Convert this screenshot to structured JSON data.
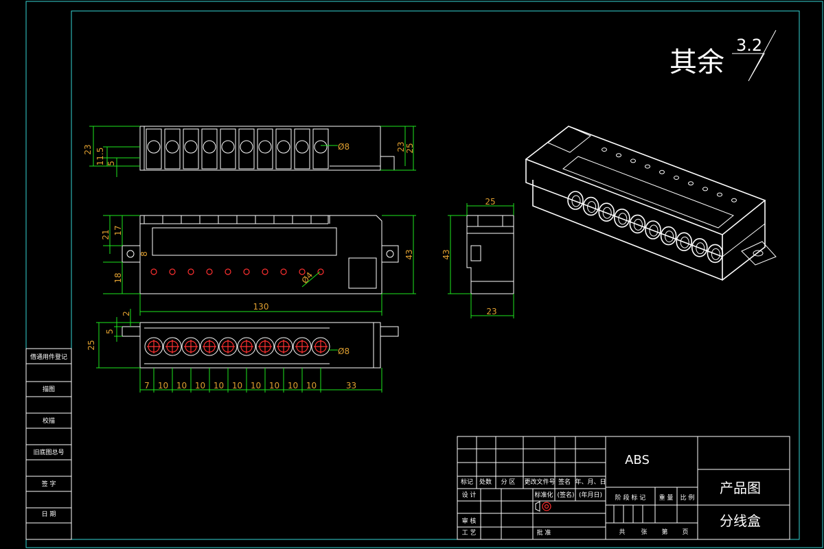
{
  "roughness": {
    "prefix": "其余",
    "value": "3.2"
  },
  "top_view": {
    "dims": {
      "height": "23",
      "mid": "11.5",
      "low": "5",
      "right_h": "23",
      "right_total": "25",
      "hole": "Ø8"
    }
  },
  "front_view": {
    "dims": {
      "left_total": "21",
      "left_top": "17",
      "tab": "8",
      "left_bottom": "18",
      "height": "43",
      "pin_hole": "Ø4",
      "length": "130"
    }
  },
  "bottom_view": {
    "dims": {
      "top": "2",
      "tab": "5",
      "height": "25",
      "hole": "Ø8"
    },
    "chain": [
      "7",
      "10",
      "10",
      "10",
      "10",
      "10",
      "10",
      "10",
      "10",
      "10",
      "33"
    ]
  },
  "side_view": {
    "dims": {
      "width_top": "25",
      "height": "43",
      "width_bottom": "23"
    }
  },
  "left_panel": {
    "labels": [
      "借通用件登记",
      "描图",
      "校描",
      "旧底图总号",
      "签 字",
      "日 期"
    ]
  },
  "title_block": {
    "material": "ABS",
    "drawing_type": "产品图",
    "part_name": "分线盒",
    "header_cells": [
      "标记",
      "处数",
      "分 区",
      "更改文件号",
      "签名",
      "年、月、日"
    ],
    "design_label": "设 计",
    "std_label": "标准化",
    "sign_label": "(签名)",
    "date_label": "(年月日)",
    "stage_cells": [
      "阶 段 标 记",
      "重 量",
      "比 例"
    ],
    "review_label": "审 核",
    "process_label": "工 艺",
    "approve_label": "批 准",
    "sheets": [
      "共",
      "张",
      "第",
      "页"
    ]
  },
  "colors": {
    "outline": "#ffffff",
    "border": "#36d6d6",
    "dimension": "#1ee81e",
    "dim_text": "#e0a030",
    "holes": "#ff3030"
  }
}
